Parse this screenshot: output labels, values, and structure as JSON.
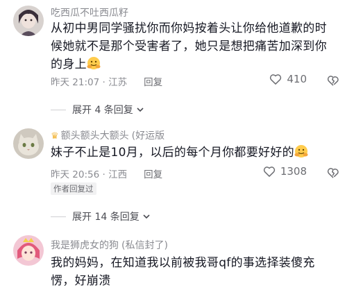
{
  "comments": [
    {
      "username": "吃西瓜不吐西瓜籽",
      "lines": [
        "从初中男同学骚扰你而你妈按着头让你给他道歉的时",
        "候她就不是那个受害者了，她只是想把痛苦加深到你",
        "的身上"
      ],
      "time": "昨天 21:07 · 江苏",
      "reply_label": "回复",
      "likes": "410",
      "expand_label": "展开 4 条回复"
    },
    {
      "username": "额头额头大额头",
      "username_tag": "(好运版",
      "lines": [
        "妹子不止是10月，以后的每个月你都要好好的"
      ],
      "time": "昨天 20:56 · 江西",
      "reply_label": "回复",
      "likes": "1308",
      "author_replied": "作者回复过",
      "expand_label": "展开 14 条回复"
    },
    {
      "username": "我是狮虎女的狗",
      "username_tag": "(私信封了)",
      "lines": [
        "我的妈妈，在知道我以前被我哥qf的事选择装傻充",
        "愣，好崩溃"
      ]
    }
  ],
  "icons": {
    "like": "heart-outline-icon",
    "dislike": "broken-heart-icon",
    "expand": "chevron-down-icon",
    "emoji": "hug-emoji-icon",
    "crown": "crown-icon"
  }
}
